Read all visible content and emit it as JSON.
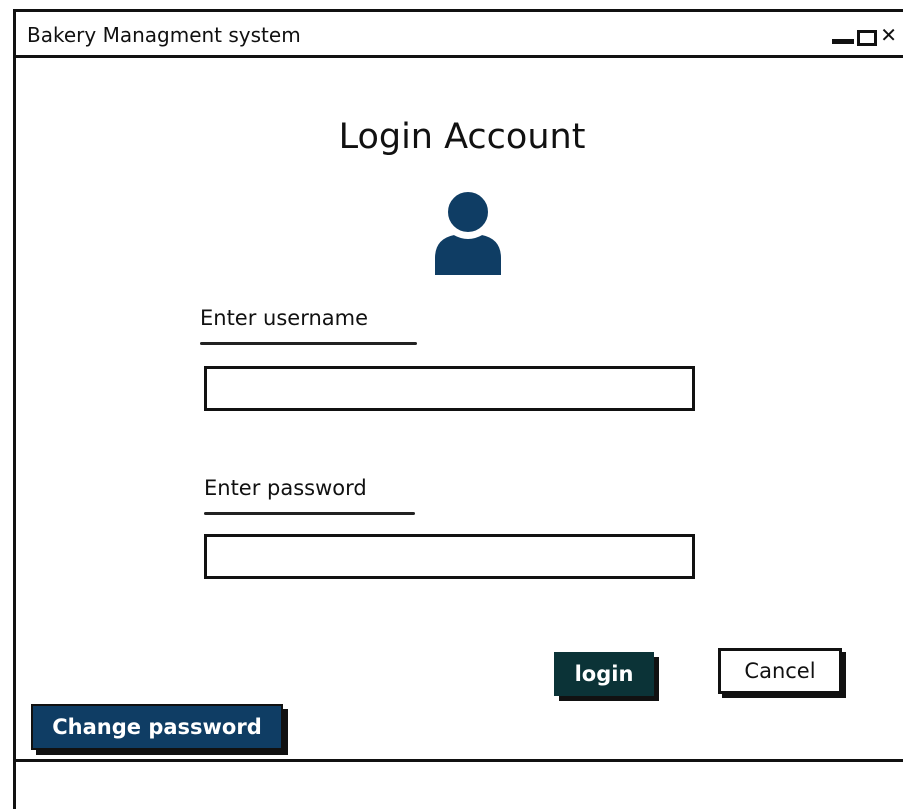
{
  "window": {
    "title": "Bakery Managment system"
  },
  "login": {
    "heading": "Login Account",
    "username_label": "Enter username",
    "username_value": "",
    "password_label": "Enter password",
    "password_value": "",
    "login_button": "login",
    "cancel_button": "Cancel",
    "change_password_button": "Change password"
  },
  "icons": {
    "avatar": "user-avatar-icon",
    "minimize": "minimize-icon",
    "maximize": "maximize-icon",
    "close": "close-icon"
  },
  "colors": {
    "avatar": "#0f3d64",
    "login_button_bg": "#0b3337",
    "change_password_bg": "#0f3d64"
  }
}
